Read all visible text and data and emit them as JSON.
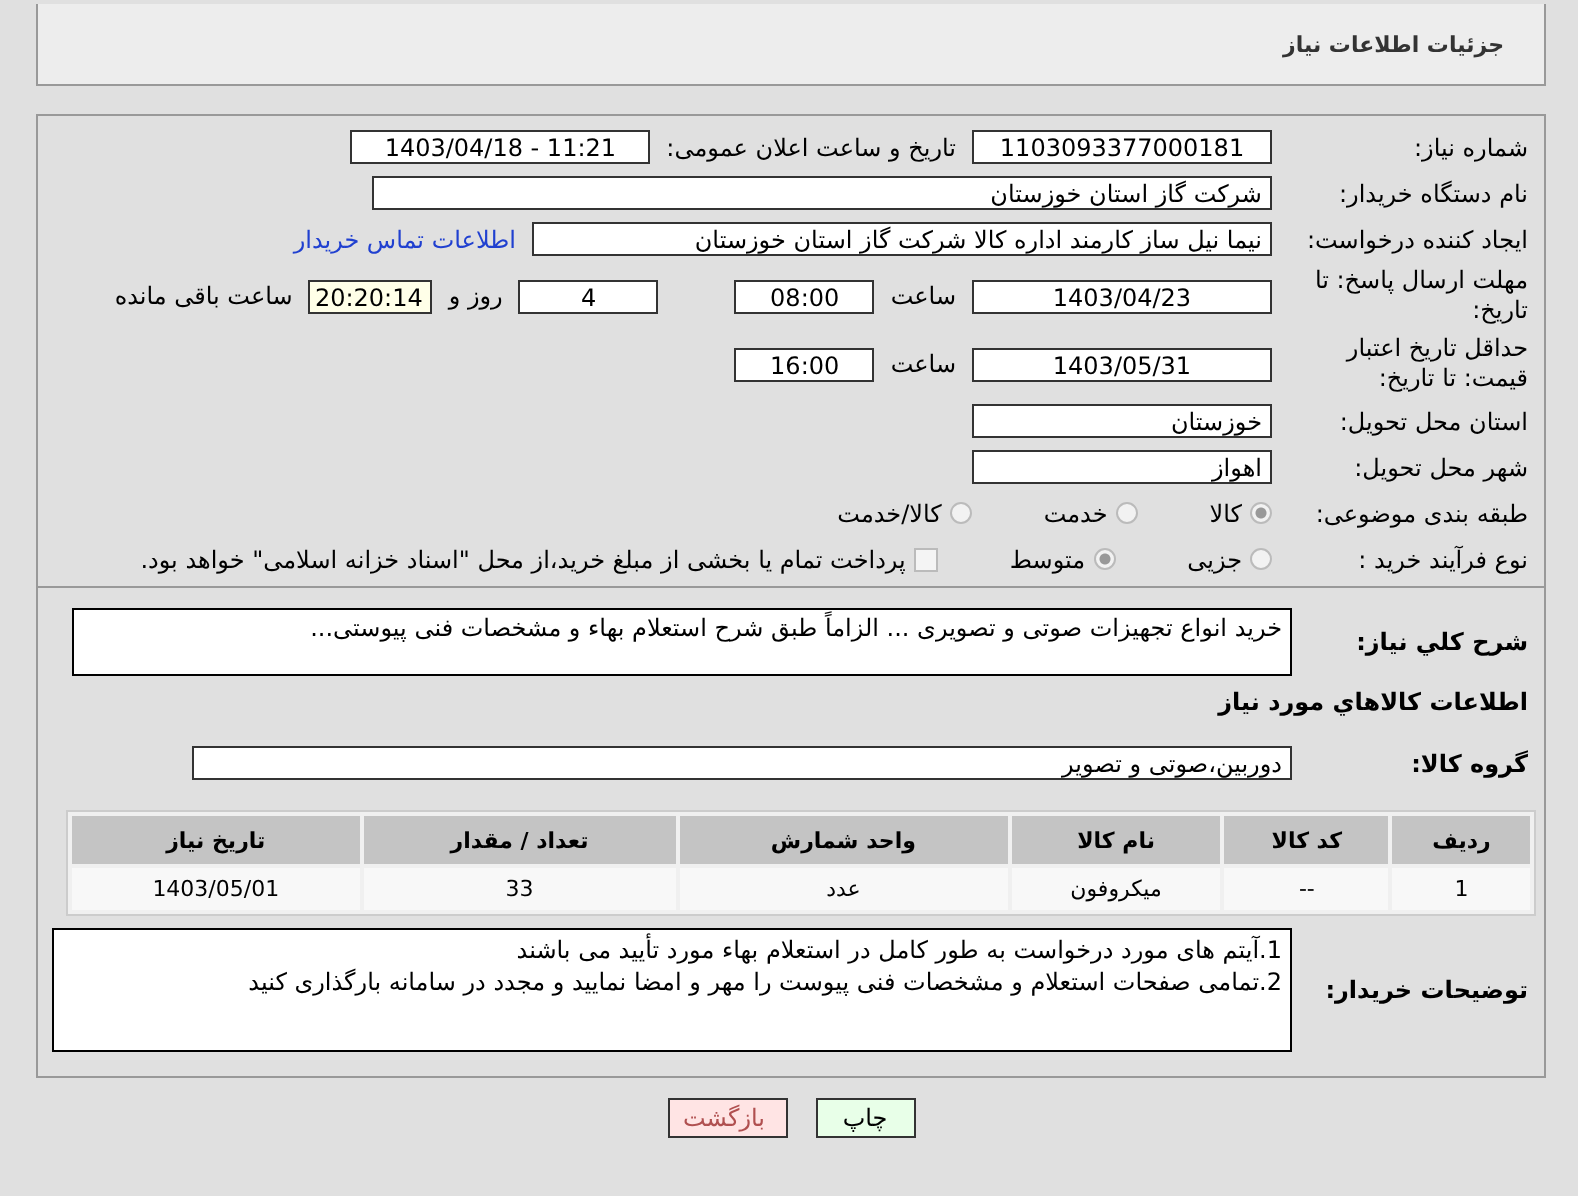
{
  "header": {
    "title": "جزئیات اطلاعات نیاز"
  },
  "fields": {
    "need_number": {
      "label": "شماره نیاز:",
      "value": "1103093377000181"
    },
    "announce": {
      "label": "تاریخ و ساعت اعلان عمومی:",
      "value": "1403/04/18 - 11:21"
    },
    "buyer": {
      "label": "نام دستگاه خریدار:",
      "value": "شرکت گاز استان خوزستان"
    },
    "creator": {
      "label": "ایجاد کننده درخواست:",
      "value": "نیما نیل ساز کارمند اداره کالا شرکت گاز استان خوزستان",
      "link": "اطلاعات تماس خریدار"
    },
    "deadline": {
      "label": "مهلت ارسال پاسخ: تا تاریخ:",
      "date": "1403/04/23",
      "time_label": "ساعت",
      "time": "08:00",
      "days": "4",
      "days_label": "روز و",
      "remaining": "20:20:14",
      "remaining_label": "ساعت باقی مانده"
    },
    "validity": {
      "label": "حداقل تاریخ اعتبار قیمت: تا تاریخ:",
      "date": "1403/05/31",
      "time_label": "ساعت",
      "time": "16:00"
    },
    "province": {
      "label": "استان محل تحویل:",
      "value": "خوزستان"
    },
    "city": {
      "label": "شهر محل تحویل:",
      "value": "اهواز"
    }
  },
  "category": {
    "label": "طبقه بندی موضوعی:",
    "options": [
      {
        "label": "کالا",
        "selected": true
      },
      {
        "label": "خدمت",
        "selected": false
      },
      {
        "label": "کالا/خدمت",
        "selected": false
      }
    ]
  },
  "process": {
    "label": "نوع فرآیند خرید :",
    "options": [
      {
        "label": "جزیی",
        "selected": false
      },
      {
        "label": "متوسط",
        "selected": true
      }
    ],
    "treasury": {
      "checked": false,
      "label": "پرداخت تمام یا بخشی از مبلغ خرید،از محل \"اسناد خزانه اسلامی\" خواهد بود."
    }
  },
  "description": {
    "label": "شرح کلي نياز:",
    "value": "خرید انواع تجهیزات صوتی و تصویری ... الزاماً طبق شرح استعلام بهاء و مشخصات فنی پیوستی..."
  },
  "goods_title": "اطلاعات کالاهاي مورد نياز",
  "goods_group": {
    "label": "گروه کالا:",
    "value": "دوربین،صوتی و تصویر"
  },
  "table": {
    "columns": [
      "رديف",
      "کد کالا",
      "نام کالا",
      "واحد شمارش",
      "تعداد / مقدار",
      "تاریخ نیاز"
    ],
    "rows": [
      [
        "1",
        "--",
        "میکروفون",
        "عدد",
        "33",
        "1403/05/01"
      ]
    ]
  },
  "notes": {
    "label": "توضیحات خریدار:",
    "lines": [
      "1.آیتم های مورد درخواست به طور کامل در استعلام بهاء مورد تأیید می باشند",
      "2.تمامی صفحات استعلام و مشخصات فنی پیوست را مهر و امضا نمایید و مجدد در سامانه بارگذاری کنید"
    ]
  },
  "buttons": [
    {
      "label": "چاپ",
      "kind": "print"
    },
    {
      "label": "بازگشت",
      "kind": "back"
    }
  ]
}
